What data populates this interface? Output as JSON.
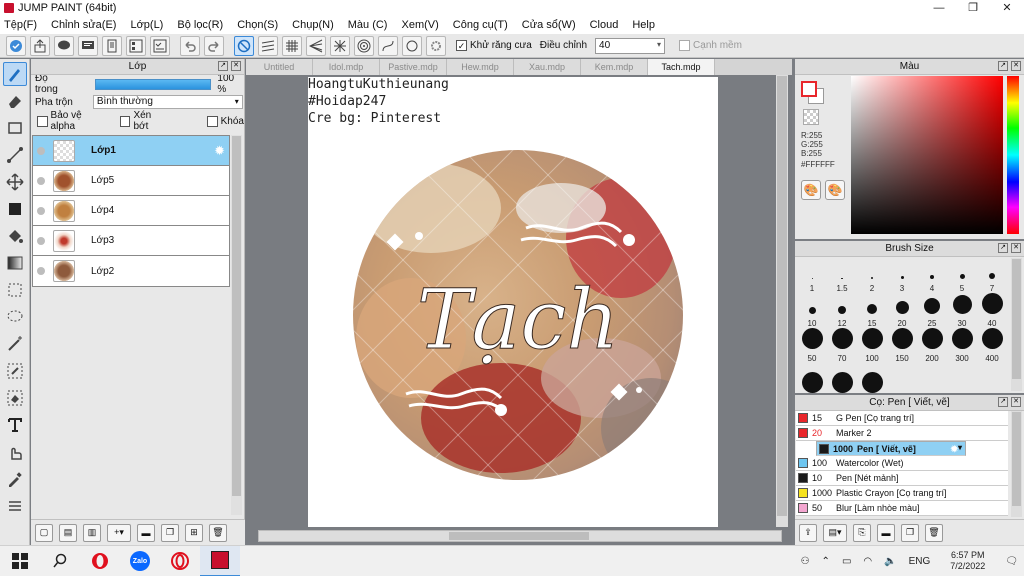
{
  "app": {
    "title": "JUMP PAINT (64bit)"
  },
  "menu": [
    "Tệp(F)",
    "Chỉnh sửa(E)",
    "Lớp(L)",
    "Bộ lọc(R)",
    "Chọn(S)",
    "Chụp(N)",
    "Màu (C)",
    "Xem(V)",
    "Công cụ(T)",
    "Cửa sổ(W)",
    "Cloud",
    "Help"
  ],
  "toolbar": {
    "antialias_label": "Khử răng cưa",
    "adjust_label": "Điều chỉnh",
    "adjust_value": "40",
    "edge_label": "Cạnh mềm"
  },
  "layer_panel": {
    "title": "Lớp",
    "opacity_label": "Độ trong",
    "opacity_value": "100 %",
    "blend_label": "Pha trộn",
    "blend_value": "Bình thường",
    "protect_alpha": "Bảo vệ alpha",
    "clipping": "Xén bớt",
    "lock": "Khóa",
    "layers": [
      {
        "name": "Lớp1"
      },
      {
        "name": "Lớp5"
      },
      {
        "name": "Lớp4"
      },
      {
        "name": "Lớp3"
      },
      {
        "name": "Lớp2"
      }
    ]
  },
  "tabs": [
    "Untitled",
    "Idol.mdp",
    "Pastive.mdp",
    "Hew.mdp",
    "Xau.mdp",
    "Kem.mdp",
    "Tach.mdp"
  ],
  "canvas": {
    "lines": [
      "HoangtuKuthieunang",
      "#Hoidap247",
      "Cre bg: Pinterest"
    ],
    "art_text": "Tạch"
  },
  "color_panel": {
    "title": "Màu",
    "r": "R:255",
    "g": "G:255",
    "b": "B:255",
    "hex": "#FFFFFF"
  },
  "brush_panel": {
    "title": "Brush Size",
    "sizes": [
      "1",
      "1.5",
      "2",
      "3",
      "4",
      "5",
      "7",
      "10",
      "12",
      "15",
      "20",
      "25",
      "30",
      "40",
      "50",
      "70",
      "100",
      "150",
      "200",
      "300",
      "400",
      "",
      "",
      ""
    ]
  },
  "pen_panel": {
    "title": "Cọ: Pen [ Viết, vẽ]",
    "pens": [
      {
        "size": "15",
        "name": "G Pen [Cọ trang trí]",
        "color": "#e8262b"
      },
      {
        "size": "20",
        "name": "Marker 2",
        "color": "#e8262b"
      },
      {
        "size": "1000",
        "name": "Pen [ Viết, vẽ]",
        "color": "#1a1a1a"
      },
      {
        "size": "100",
        "name": "Watercolor (Wet)",
        "color": "#6ec6f0"
      },
      {
        "size": "10",
        "name": "Pen [Nét mảnh]",
        "color": "#1a1a1a"
      },
      {
        "size": "1000",
        "name": "Plastic Crayon [Cọ trang trí]",
        "color": "#f5e21f"
      },
      {
        "size": "50",
        "name": "Blur [Làm nhòe màu]",
        "color": "#f3a6d0"
      }
    ]
  },
  "taskbar": {
    "lang": "ENG",
    "time": "6:57 PM",
    "date": "7/2/2022",
    "zalo_label": "Zalo"
  }
}
